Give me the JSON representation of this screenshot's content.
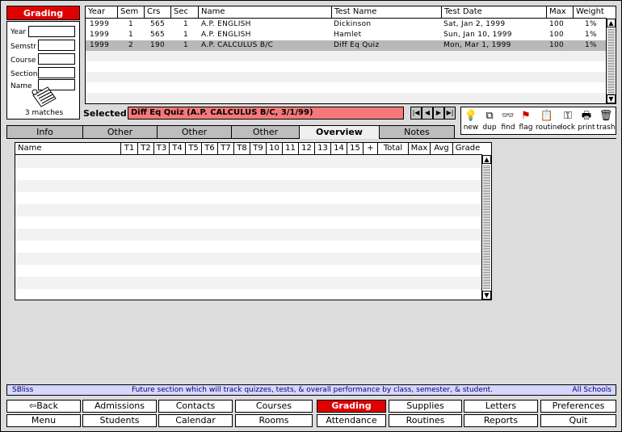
{
  "search_panel": {
    "title": "Grading",
    "fields": [
      "Year",
      "Semstr",
      "Course",
      "Section",
      "Name"
    ],
    "matches": "3 matches"
  },
  "top_table": {
    "headers": [
      "Year",
      "Sem",
      "Crs",
      "Sec",
      "Name",
      "Test Name",
      "Test Date",
      "Max",
      "Weight"
    ],
    "rows": [
      [
        "1999",
        "1",
        "565",
        "1",
        "A.P. ENGLISH",
        "Dickinson",
        "Sat, Jan 2, 1999",
        "100",
        "1%"
      ],
      [
        "1999",
        "1",
        "565",
        "1",
        "A.P. ENGLISH",
        "Hamlet",
        "Sun, Jan 10, 1999",
        "100",
        "1%"
      ],
      [
        "1999",
        "2",
        "190",
        "1",
        "A.P. CALCULUS B/C",
        "Diff Eq Quiz",
        "Mon, Mar 1, 1999",
        "100",
        "1%"
      ]
    ],
    "selected_row": 2
  },
  "selected": {
    "label": "Selected:",
    "value": "Diff Eq Quiz (A.P. CALCULUS B/C, 3/1/99)"
  },
  "record_nav": [
    "first-icon",
    "prev-icon",
    "next-icon",
    "last-icon"
  ],
  "toolbar": [
    {
      "icon": "lightbulb-icon",
      "glyph": "💡",
      "label": "new"
    },
    {
      "icon": "duplicate-icon",
      "glyph": "⧉",
      "label": "dup"
    },
    {
      "icon": "glasses-icon",
      "glyph": "👓",
      "label": "find"
    },
    {
      "icon": "flag-icon",
      "glyph": "⚑",
      "label": "flag"
    },
    {
      "icon": "clipboard-icon",
      "glyph": "📋",
      "label": "routine"
    },
    {
      "icon": "key-icon",
      "glyph": "⚿",
      "label": "lock"
    },
    {
      "icon": "printer-icon",
      "glyph": "🖶",
      "label": "print"
    },
    {
      "icon": "trash-icon",
      "glyph": "🗑",
      "label": "trash"
    }
  ],
  "tabs": [
    {
      "label": "Info",
      "active": false
    },
    {
      "label": "Other",
      "active": false
    },
    {
      "label": "Other",
      "active": false
    },
    {
      "label": "Other",
      "active": false
    },
    {
      "label": "Overview",
      "active": true
    },
    {
      "label": "Notes",
      "active": false
    }
  ],
  "overview_grid": {
    "headers": [
      "Name",
      "T1",
      "T2",
      "T3",
      "T4",
      "T5",
      "T6",
      "T7",
      "T8",
      "T9",
      "10",
      "11",
      "12",
      "13",
      "14",
      "15",
      "+",
      "Total",
      "Max",
      "Avg",
      "Grade"
    ]
  },
  "status_bar": {
    "left": "SBliss",
    "center": "Future section which will track quizzes, tests, & overall performance by class, semester, & student.",
    "right": "All Schools"
  },
  "bottom_nav": {
    "row1": [
      "Back",
      "Admissions",
      "Contacts",
      "Courses",
      "Grading",
      "Supplies",
      "Letters",
      "Preferences"
    ],
    "row2": [
      "Menu",
      "Students",
      "Calendar",
      "Rooms",
      "Attendance",
      "Routines",
      "Reports",
      "Quit"
    ],
    "active": "Grading"
  }
}
